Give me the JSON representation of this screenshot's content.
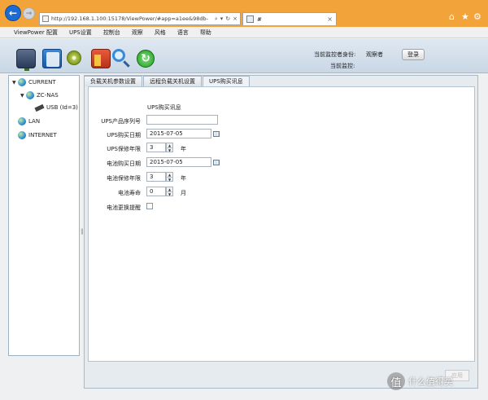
{
  "browser": {
    "url": "http://192.168.1.100:15178/ViewPower/#app=a1ee&98db-",
    "tab_title": "#",
    "search_glyph": "⌕",
    "dropdown_glyph": "▾",
    "refresh_glyph": "↻",
    "back_glyph": "←",
    "forward_glyph": "→",
    "close_glyph": "×",
    "home_glyph": "⌂",
    "star_glyph": "★",
    "gear_glyph": "⚙"
  },
  "menubar": {
    "items": [
      "ViewPower 配置",
      "UPS设置",
      "控制台",
      "观察",
      "风格",
      "语言",
      "帮助"
    ]
  },
  "toolbar": {
    "identity_label": "当前监控者身份:",
    "identity_value": "观察者",
    "login_button": "登录",
    "current_monitor_label": "当前监控:"
  },
  "tree": {
    "current": "CURRENT",
    "nas": "ZC-NAS",
    "usb": "USB (Id=3)",
    "lan": "LAN",
    "internet": "INTERNET",
    "expand_glyph": "▼",
    "splitter_glyph": "‖"
  },
  "tabs": [
    "负载关机参数设置",
    "远程负载关机设置",
    "UPS购买讯息"
  ],
  "form": {
    "section_title": "UPS购买讯息",
    "serial_label": "UPS产品序列号",
    "purchase_date_label": "UPS购买日期",
    "purchase_date_value": "2015-07-05",
    "warranty_label": "UPS保修年限",
    "warranty_value": "3",
    "warranty_unit": "年",
    "battery_date_label": "电池购买日期",
    "battery_date_value": "2015-07-05",
    "battery_warranty_label": "电池保修年限",
    "battery_warranty_value": "3",
    "battery_warranty_unit": "年",
    "battery_life_label": "电池寿命",
    "battery_life_value": "0",
    "battery_life_unit": "月",
    "battery_reminder_label": "电池更换提醒",
    "spin_up": "▲",
    "spin_down": "▼",
    "apply_button": "应用"
  },
  "watermark": {
    "glyph": "值",
    "text": "什么值得买"
  }
}
